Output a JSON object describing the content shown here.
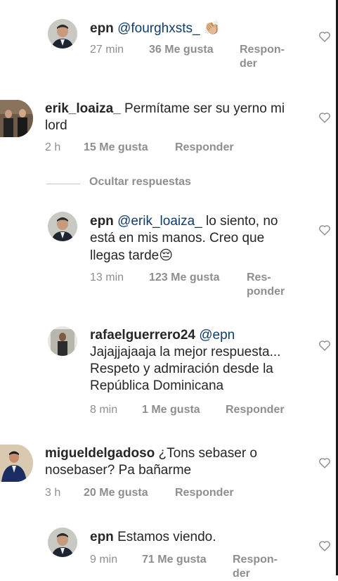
{
  "comments": [
    {
      "user": "epn",
      "mention": "@fourghxsts_",
      "text": "",
      "emoji": "👏🏼",
      "time": "27 min",
      "likes": "36 Me gusta",
      "reply_line1": "Respon-",
      "reply_line2": "der"
    },
    {
      "user": "erik_loaiza_",
      "text": "Permítame ser su yerno mi lord",
      "time": "2 h",
      "likes": "15 Me gusta",
      "reply": "Responder"
    },
    {
      "user": "epn",
      "mention": "@erik_loaiza_",
      "text": "lo siento, no está en mis manos. Creo que llegas tarde",
      "emoji": "😔",
      "time": "13 min",
      "likes": "123 Me gusta",
      "reply_line1": "Res-",
      "reply_line2": "ponder"
    },
    {
      "user": "rafaelguerrero24",
      "mention": "@epn",
      "text": "Jajajjajaaja la mejor respuesta... Respeto y admiración desde la República Dominicana",
      "time": "8 min",
      "likes": "1 Me gusta",
      "reply": "Responder"
    },
    {
      "user": "migueldelgadoso",
      "text": "¿Tons sebaser o nosebaser? Pa bañarme",
      "time": "3 h",
      "likes": "20 Me gusta",
      "reply": "Responder"
    },
    {
      "user": "epn",
      "text": "Estamos viendo.",
      "time": "9 min",
      "likes": "71 Me gusta",
      "reply_line1": "Respon-",
      "reply_line2": "der"
    }
  ],
  "hide_replies": "Ocultar respuestas",
  "icons": {
    "like": "heart-outline-icon"
  },
  "colors": {
    "mention": "#0f3d6b",
    "meta": "#8e8e8e",
    "text": "#262626"
  }
}
